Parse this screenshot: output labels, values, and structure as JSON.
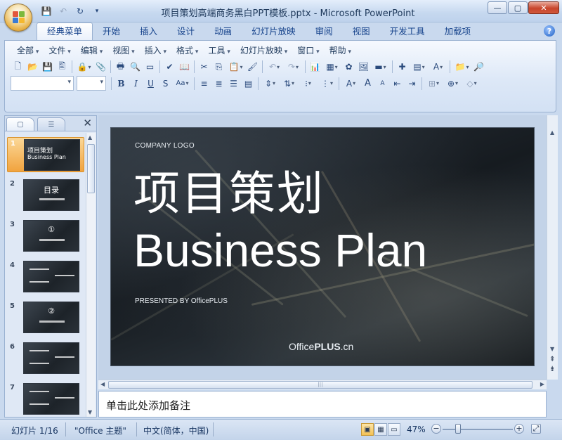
{
  "window": {
    "title": "项目策划高端商务黑白PPT模板.pptx - Microsoft PowerPoint",
    "minimize_glyph": "—",
    "maximize_glyph": "▢",
    "close_glyph": "✕"
  },
  "quick_access": {
    "icons": [
      "save-icon",
      "undo-icon",
      "redo-icon",
      "customize-icon"
    ],
    "glyphs": [
      "💾",
      "↶",
      "↻",
      "▾"
    ]
  },
  "ribbon_tabs": [
    "经典菜单",
    "开始",
    "插入",
    "设计",
    "动画",
    "幻灯片放映",
    "审阅",
    "视图",
    "开发工具",
    "加载项"
  ],
  "active_tab": "经典菜单",
  "help_glyph": "?",
  "classic_menu": [
    "全部",
    "文件",
    "编辑",
    "视图",
    "插入",
    "格式",
    "工具",
    "幻灯片放映",
    "窗口",
    "帮助"
  ],
  "toolbar_row1": {
    "groups": [
      [
        "new-icon",
        "open-icon",
        "save-icon",
        "print-preview-icon"
      ],
      [
        "permission-icon",
        "attach-icon"
      ],
      [
        "print-icon",
        "preview-icon",
        "view-icon"
      ],
      [
        "spelling-icon",
        "research-icon"
      ],
      [
        "cut-icon",
        "copy-icon",
        "paste-icon",
        "format-painter-icon"
      ],
      [
        "undo-icon",
        "redo-icon"
      ],
      [
        "chart-icon",
        "table-icon",
        "clipart-icon",
        "picture-icon",
        "shape-icon"
      ],
      [
        "insert-new-icon",
        "layout-icon",
        "text-box-icon"
      ],
      [
        "folder-icon",
        "find-icon"
      ]
    ],
    "glyphs": {
      "new-icon": "🗋",
      "open-icon": "📂",
      "save-icon": "💾",
      "print-preview-icon": "🖺",
      "permission-icon": "🔒",
      "attach-icon": "📎",
      "print-icon": "🖶",
      "preview-icon": "🔍",
      "view-icon": "▭",
      "spelling-icon": "✔",
      "research-icon": "📖",
      "cut-icon": "✂",
      "copy-icon": "⎘",
      "paste-icon": "📋",
      "format-painter-icon": "🖌",
      "undo-icon": "↶",
      "redo-icon": "↷",
      "chart-icon": "📊",
      "table-icon": "▦",
      "clipart-icon": "✿",
      "picture-icon": "🖼",
      "shape-icon": "▬",
      "insert-new-icon": "✚",
      "layout-icon": "▤",
      "text-box-icon": "A",
      "folder-icon": "📁",
      "find-icon": "🔎"
    }
  },
  "toolbar_row2": {
    "font_name": "",
    "font_size": "",
    "format_glyphs": [
      "B",
      "I",
      "U",
      "S",
      "Aa"
    ],
    "align_glyphs": [
      "≡",
      "≣",
      "☰",
      "▤"
    ],
    "para_glyphs": [
      "⇕",
      "⇅",
      "⁝",
      "⋮"
    ],
    "font_glyphs": [
      "A",
      "A",
      "A",
      "⇤",
      "⇥"
    ],
    "misc_glyphs": [
      "⊞",
      "⊕",
      "◇"
    ]
  },
  "slides_pane": {
    "tab_slides_glyph": "▢",
    "tab_outline_glyph": "☰",
    "close_glyph": "✕",
    "slides": [
      {
        "number": "1",
        "active": true,
        "line1": "项目策划",
        "line2": "Business Plan"
      },
      {
        "number": "2",
        "active": false,
        "line1": "目录",
        "line2": ""
      },
      {
        "number": "3",
        "active": false,
        "line1": "①",
        "line2": ""
      },
      {
        "number": "4",
        "active": false,
        "line1": "",
        "line2": ""
      },
      {
        "number": "5",
        "active": false,
        "line1": "②",
        "line2": ""
      },
      {
        "number": "6",
        "active": false,
        "line1": "",
        "line2": ""
      },
      {
        "number": "7",
        "active": false,
        "line1": "",
        "line2": ""
      }
    ]
  },
  "slide": {
    "company_logo": "COMPANY LOGO",
    "title_cn": "项目策划",
    "title_en": "Business Plan",
    "presented_by": "PRESENTED BY OfficePLUS",
    "brand_prefix": "Office",
    "brand_bold": "PLUS",
    "brand_suffix": ".cn"
  },
  "notes": {
    "placeholder": "单击此处添加备注"
  },
  "status": {
    "slide_info": "幻灯片 1/16",
    "theme": "\"Office 主题\"",
    "language": "中文(简体，中国)",
    "zoom": "47%",
    "zoom_out_glyph": "−",
    "zoom_in_glyph": "+",
    "fit_glyph": "⤢"
  }
}
